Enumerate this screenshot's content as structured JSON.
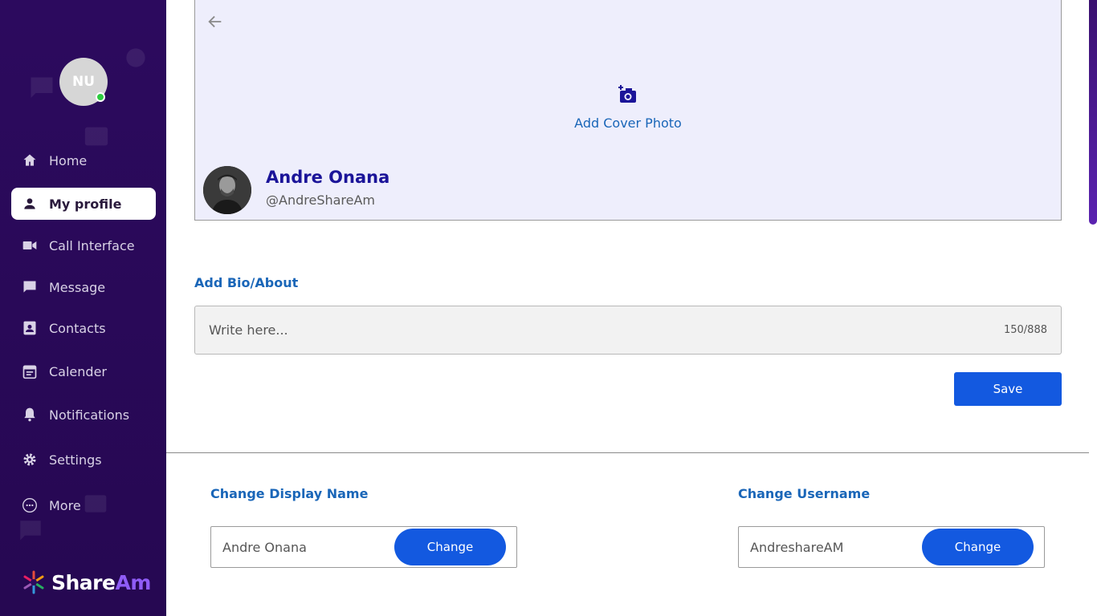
{
  "sidebar": {
    "avatar_initials": "NU",
    "online": true,
    "items": [
      {
        "label": "Home",
        "icon": "home-icon"
      },
      {
        "label": "My profile",
        "icon": "person-icon"
      },
      {
        "label": "Call Interface",
        "icon": "video-icon"
      },
      {
        "label": "Message",
        "icon": "message-icon"
      },
      {
        "label": "Contacts",
        "icon": "contact-card-icon"
      },
      {
        "label": "Calender",
        "icon": "calendar-icon"
      },
      {
        "label": "Notifications",
        "icon": "bell-icon"
      },
      {
        "label": "Settings",
        "icon": "gear-icon"
      },
      {
        "label": "More",
        "icon": "more-icon"
      }
    ],
    "active_item": "My profile",
    "logo": {
      "part1": "Share",
      "part2": "Am"
    }
  },
  "profile": {
    "cover_label": "Add Cover Photo",
    "name": "Andre Onana",
    "handle": "@AndreShareAm"
  },
  "bio": {
    "label": "Add Bio/About",
    "placeholder": "Write here...",
    "counter": "150/888",
    "save_label": "Save"
  },
  "display_name": {
    "label": "Change Display Name",
    "value": "Andre Onana",
    "button": "Change"
  },
  "username": {
    "label": "Change Username",
    "value": "AndreshareAM",
    "button": "Change"
  },
  "colors": {
    "sidebar_bg": "#2c0a5e",
    "accent_blue": "#1359e0",
    "link_blue": "#1a66b8",
    "name_blue": "#1b1499",
    "online": "#2ecc40"
  }
}
